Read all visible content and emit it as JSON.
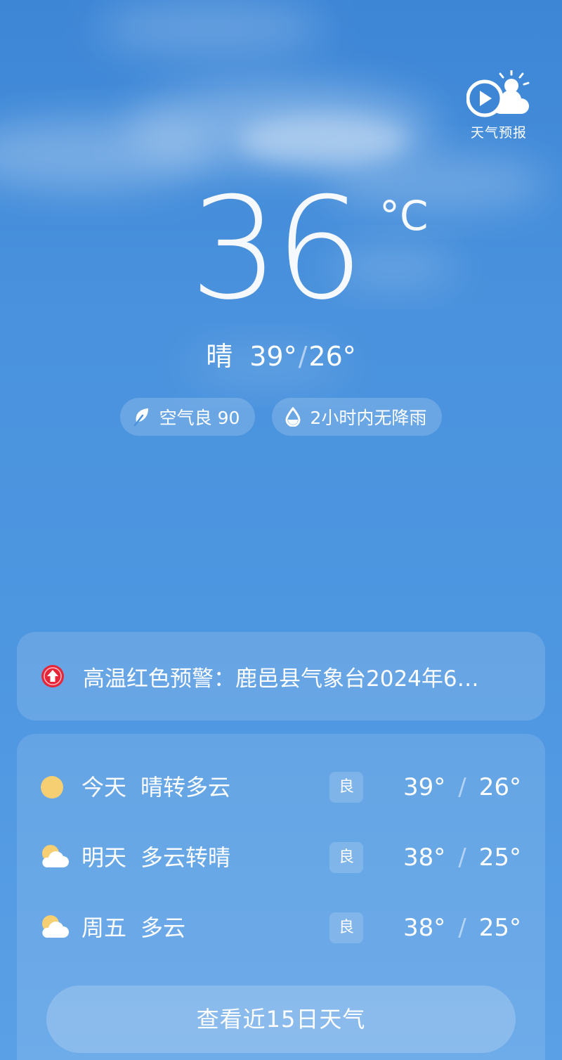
{
  "colors": {
    "sky_top": "#3d86d6",
    "sky_bottom": "#5aa0e6",
    "alert_red": "#e8263a",
    "sun_yellow": "#f6cf72"
  },
  "video_forecast": {
    "label": "天气预报",
    "icon": "play-cloud-sun-icon"
  },
  "current": {
    "temperature": "36",
    "unit": "°C",
    "condition": "晴",
    "high": "39°",
    "low": "26°",
    "separator": "/"
  },
  "chips": [
    {
      "icon": "leaf-icon",
      "label": "空气良 90"
    },
    {
      "icon": "water-drop-icon",
      "label": "2小时内无降雨"
    }
  ],
  "alert": {
    "icon": "arrow-up-warning-icon",
    "text": "高温红色预警：鹿邑县气象台2024年6…"
  },
  "forecast": [
    {
      "day": "今天",
      "condition": "晴转多云",
      "icon": "sun-icon",
      "aqi": "良",
      "high": "39°",
      "low": "26°"
    },
    {
      "day": "明天",
      "condition": "多云转晴",
      "icon": "partly-cloudy-icon",
      "aqi": "良",
      "high": "38°",
      "low": "25°"
    },
    {
      "day": "周五",
      "condition": "多云",
      "icon": "partly-cloudy-icon",
      "aqi": "良",
      "high": "38°",
      "low": "25°"
    }
  ],
  "more_button": "查看近15日天气"
}
